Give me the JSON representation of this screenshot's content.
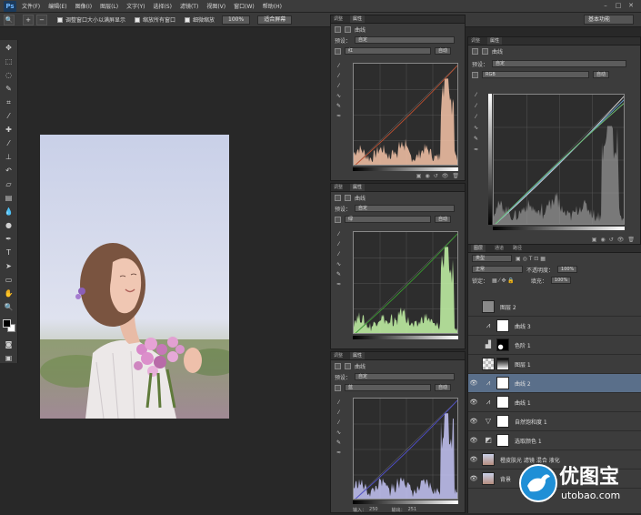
{
  "app": {
    "logo": "Ps"
  },
  "menu": [
    "文件(F)",
    "编辑(E)",
    "图像(I)",
    "图层(L)",
    "文字(Y)",
    "选择(S)",
    "滤镜(T)",
    "视图(V)",
    "窗口(W)",
    "帮助(H)"
  ],
  "options_bar": {
    "resize_windows_label": "调整窗口大小以满屏显示",
    "zoom_all_label": "缩放所有窗口",
    "scrubby_zoom_label": "细微缩放",
    "zoom_100": "100%",
    "fit_screen": "适合屏幕",
    "workspace": "基本功能"
  },
  "curves_panels": [
    {
      "tab_a": "调整",
      "tab_b": "属性",
      "title": "曲线",
      "preset_label": "预设：",
      "preset": "自定",
      "channel": "红",
      "auto": "自动",
      "hist_color": "#f7c4a8",
      "curve_color": "#c05030"
    },
    {
      "tab_a": "调整",
      "tab_b": "属性",
      "title": "曲线",
      "preset_label": "预设：",
      "preset": "自定",
      "channel": "绿",
      "auto": "自动",
      "hist_color": "#c6f7a8",
      "curve_color": "#3aa030"
    },
    {
      "tab_a": "调整",
      "tab_b": "属性",
      "title": "曲线",
      "preset_label": "预设：",
      "preset": "自定",
      "channel": "蓝",
      "auto": "自动",
      "hist_color": "#c6c6f7",
      "curve_color": "#5050d0",
      "input_label": "输入：",
      "input_value": "250",
      "output_label": "输出：",
      "output_value": "251"
    },
    {
      "tab_a": "调整",
      "tab_b": "属性",
      "title": "曲线",
      "preset_label": "预设：",
      "preset": "自定",
      "channel": "RGB",
      "auto": "自动",
      "hist_color": "#9a9a9a",
      "curve_color": "#d0d0d0"
    }
  ],
  "layers_panel": {
    "tabs": [
      "图层",
      "通道",
      "路径"
    ],
    "kind": "类型",
    "blend_mode": "正常",
    "opacity_label": "不透明度：",
    "opacity": "100%",
    "lock_label": "锁定：",
    "fill_label": "填充：",
    "fill": "100%",
    "layers": [
      {
        "name": "图层 2",
        "type": "pixel",
        "selected": false,
        "visible": false
      },
      {
        "name": "曲线 3",
        "type": "curves",
        "selected": false,
        "visible": false
      },
      {
        "name": "色阶 1",
        "type": "levels",
        "selected": false,
        "visible": false
      },
      {
        "name": "图层 1",
        "type": "pixel",
        "selected": false,
        "visible": false
      },
      {
        "name": "曲线 2",
        "type": "curves",
        "selected": true,
        "visible": true
      },
      {
        "name": "曲线 1",
        "type": "curves",
        "selected": false,
        "visible": true
      },
      {
        "name": "自然饱和度 1",
        "type": "vibrance",
        "selected": false,
        "visible": true
      },
      {
        "name": "选取颜色 1",
        "type": "selective",
        "selected": false,
        "visible": true
      },
      {
        "name": "橙皮肤光 滤镜 混合 液化",
        "type": "photo",
        "selected": false,
        "visible": true
      },
      {
        "name": "背景",
        "type": "photo",
        "selected": false,
        "visible": true
      }
    ]
  },
  "watermark": {
    "brand": "优图宝",
    "url": "utobao.com"
  }
}
